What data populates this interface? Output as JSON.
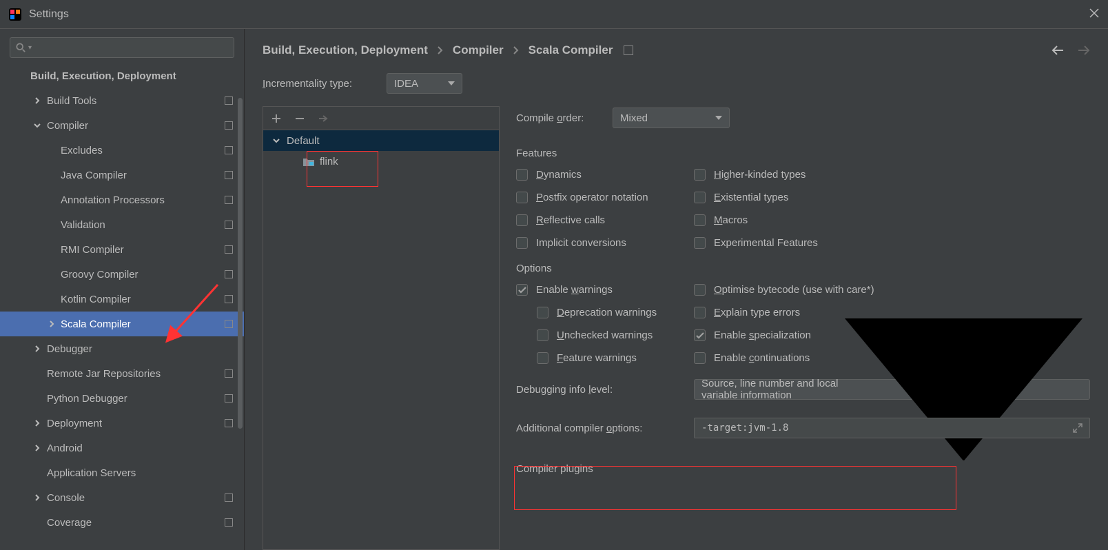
{
  "window": {
    "title": "Settings"
  },
  "sidebar": {
    "items": [
      {
        "label": "Build, Execution, Deployment",
        "lvl": 0,
        "chev": "",
        "proj": false
      },
      {
        "label": "Build Tools",
        "lvl": 1,
        "chev": "r",
        "proj": true
      },
      {
        "label": "Compiler",
        "lvl": 1,
        "chev": "d",
        "proj": true
      },
      {
        "label": "Excludes",
        "lvl": 2,
        "chev": "",
        "proj": true
      },
      {
        "label": "Java Compiler",
        "lvl": 2,
        "chev": "",
        "proj": true
      },
      {
        "label": "Annotation Processors",
        "lvl": 2,
        "chev": "",
        "proj": true
      },
      {
        "label": "Validation",
        "lvl": 2,
        "chev": "",
        "proj": true
      },
      {
        "label": "RMI Compiler",
        "lvl": 2,
        "chev": "",
        "proj": true
      },
      {
        "label": "Groovy Compiler",
        "lvl": 2,
        "chev": "",
        "proj": true
      },
      {
        "label": "Kotlin Compiler",
        "lvl": 2,
        "chev": "",
        "proj": true
      },
      {
        "label": "Scala Compiler",
        "lvl": 2,
        "chev": "r",
        "proj": true,
        "selected": true
      },
      {
        "label": "Debugger",
        "lvl": 1,
        "chev": "r",
        "proj": false
      },
      {
        "label": "Remote Jar Repositories",
        "lvl": 1,
        "chev": "",
        "proj": true
      },
      {
        "label": "Python Debugger",
        "lvl": 1,
        "chev": "",
        "proj": true
      },
      {
        "label": "Deployment",
        "lvl": 1,
        "chev": "r",
        "proj": true
      },
      {
        "label": "Android",
        "lvl": 1,
        "chev": "r",
        "proj": false
      },
      {
        "label": "Application Servers",
        "lvl": 1,
        "chev": "",
        "proj": false
      },
      {
        "label": "Console",
        "lvl": 1,
        "chev": "r",
        "proj": true
      },
      {
        "label": "Coverage",
        "lvl": 1,
        "chev": "",
        "proj": true
      }
    ]
  },
  "breadcrumb": {
    "parts": [
      "Build, Execution, Deployment",
      "Compiler",
      "Scala Compiler"
    ]
  },
  "main": {
    "incrementality_label": "Incrementality type:",
    "incrementality_value": "IDEA",
    "profile_default": "Default",
    "profile_module": "flink",
    "compile_order_label": "Compile order:",
    "compile_order_value": "Mixed",
    "features_header": "Features",
    "features_col1": [
      {
        "label_pre": "",
        "mne": "D",
        "label_post": "ynamics",
        "checked": false
      },
      {
        "label_pre": "",
        "mne": "P",
        "label_post": "ostfix operator notation",
        "checked": false
      },
      {
        "label_pre": "",
        "mne": "R",
        "label_post": "eflective calls",
        "checked": false
      },
      {
        "label_pre": "Implicit conversions",
        "mne": "",
        "label_post": "",
        "checked": false
      }
    ],
    "features_col2": [
      {
        "label_pre": "",
        "mne": "H",
        "label_post": "igher-kinded types",
        "checked": false
      },
      {
        "label_pre": "",
        "mne": "E",
        "label_post": "xistential types",
        "checked": false
      },
      {
        "label_pre": "",
        "mne": "M",
        "label_post": "acros",
        "checked": false
      },
      {
        "label_pre": "Experimental Features",
        "mne": "",
        "label_post": "",
        "checked": false
      }
    ],
    "options_header": "Options",
    "options_col1": [
      {
        "label_pre": "Enable ",
        "mne": "w",
        "label_post": "arnings",
        "checked": true,
        "indent": false
      },
      {
        "label_pre": "",
        "mne": "D",
        "label_post": "eprecation warnings",
        "checked": false,
        "indent": true
      },
      {
        "label_pre": "",
        "mne": "U",
        "label_post": "nchecked warnings",
        "checked": false,
        "indent": true
      },
      {
        "label_pre": "",
        "mne": "F",
        "label_post": "eature warnings",
        "checked": false,
        "indent": true
      }
    ],
    "options_col2": [
      {
        "label_pre": "",
        "mne": "O",
        "label_post": "ptimise bytecode (use with care*)",
        "checked": false
      },
      {
        "label_pre": "",
        "mne": "E",
        "label_post": "xplain type errors",
        "checked": false
      },
      {
        "label_pre": "Enable ",
        "mne": "s",
        "label_post": "pecialization",
        "checked": true
      },
      {
        "label_pre": "Enable ",
        "mne": "c",
        "label_post": "ontinuations",
        "checked": false
      }
    ],
    "debug_label": "Debugging info level:",
    "debug_value": "Source, line number and local variable information",
    "addopts_label": "Additional compiler options:",
    "addopts_value": "-target:jvm-1.8",
    "plugins_header": "Compiler plugins"
  }
}
